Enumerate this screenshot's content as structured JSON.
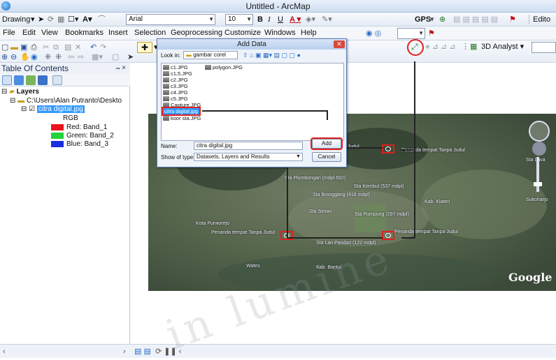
{
  "window": {
    "title": "Untitled - ArcMap"
  },
  "toolbar1": {
    "drawing": "Drawing",
    "font": "Arial",
    "size": "10",
    "bold": "B",
    "italic": "I",
    "underline": "U",
    "gps": "GPS",
    "edit": "Edito"
  },
  "menu": [
    "File",
    "Edit",
    "View",
    "Bookmarks",
    "Insert",
    "Selection",
    "Geoprocessing",
    "Customize",
    "Windows",
    "Help"
  ],
  "toolbar3": {
    "analyst": "3D Analyst"
  },
  "toc": {
    "title": "Table Of Contents",
    "pin": "⫬ ×",
    "layers": "Layers",
    "path": "C:\\Users\\Alan Putranto\\Deskto",
    "layer": "citra digital.jpg",
    "rgb": "RGB",
    "bands": [
      {
        "label": "Red:   Band_1",
        "color": "#e8141e"
      },
      {
        "label": "Green: Band_2",
        "color": "#22d23a"
      },
      {
        "label": "Blue:   Band_3",
        "color": "#1a2fe0"
      }
    ]
  },
  "dialog": {
    "title": "Add Data",
    "lookin_label": "Look in:",
    "lookin_value": "gambar corel",
    "files_col1": [
      "c1.JPG",
      "c1,5.JPG",
      "c2.JPG",
      "c3.JPG",
      "c4.JPG",
      "c5.JPG",
      "Capture.JPG",
      "citra digital.jpg",
      "koor sta.JPG"
    ],
    "files_col2": [
      "polygon.JPG"
    ],
    "name_label": "Name:",
    "name_value": "citra digital.jpg",
    "type_label": "Show of type:",
    "type_value": "Datasets, Layers and Results",
    "add": "Add",
    "cancel": "Cancel"
  },
  "map": {
    "labels": [
      "Sta Plumbongan (mdpl 692)",
      "Sta Kembul (537 mdpl)",
      "Sta Bronggang (418 mdpl)",
      "Sta Siman",
      "Sta Pumpung (297 mdpl)",
      "Kab. Klaten",
      "Sukoharjo",
      "Kota Purworejo",
      "Penanda tempat Tanpa Judul",
      "Penanda tempat Tanpa Judul",
      "Penanda tempat Tanpa Judul",
      "Sta Lan Pandan (122 mdpl)",
      "Wates",
      "Kab. Bantul",
      "Judul",
      "Sta Lava"
    ],
    "google": "Google"
  },
  "watermark": "in lumine"
}
